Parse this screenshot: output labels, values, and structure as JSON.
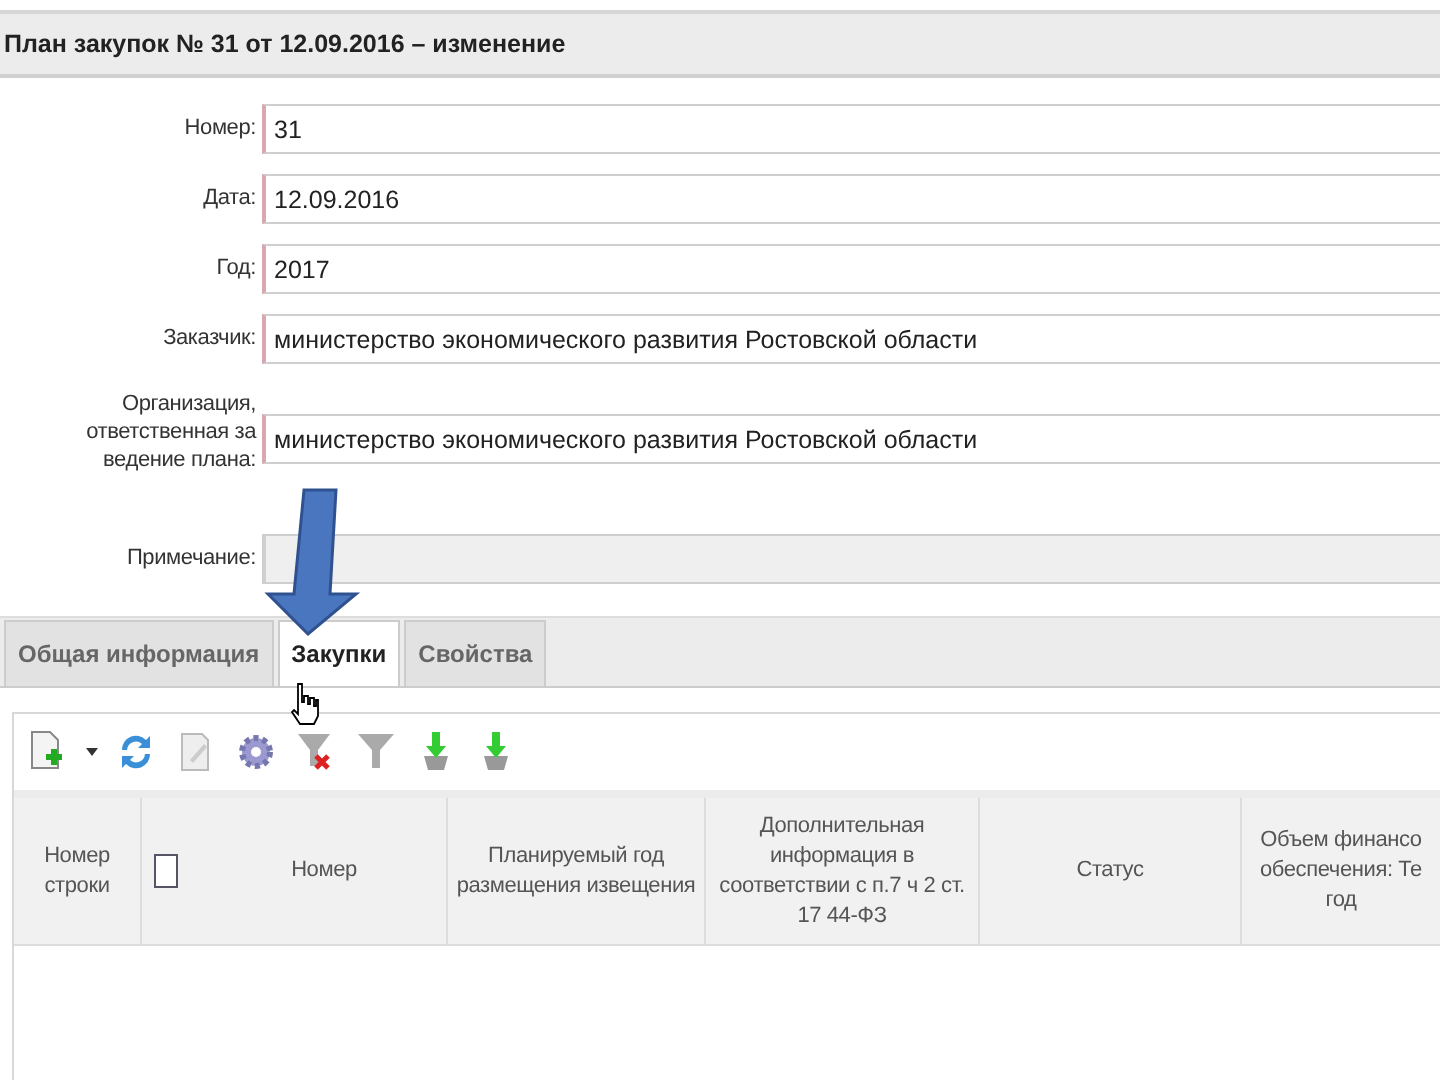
{
  "window": {
    "title": "План закупок № 31 от 12.09.2016 – изменение"
  },
  "form": [
    {
      "label": "Номер:",
      "value": "31",
      "kind": "text"
    },
    {
      "label": "Дата:",
      "value": "12.09.2016",
      "kind": "text"
    },
    {
      "label": "Год:",
      "value": "2017",
      "kind": "text"
    },
    {
      "label": "Заказчик:",
      "value": "министерство экономического развития Ростовской области",
      "kind": "text"
    },
    {
      "label": "Организация, ответственная за ведение плана:",
      "value": "министерство экономического развития Ростовской области",
      "kind": "tall"
    },
    {
      "label": "Примечание:",
      "kind": "note"
    }
  ],
  "tabs": [
    {
      "label": "Общая информация",
      "selected": false
    },
    {
      "label": "Закупки",
      "selected": true
    },
    {
      "label": "Свойства",
      "selected": false
    }
  ],
  "toolbar": [
    {
      "kind": "add"
    },
    {
      "kind": "refresh"
    },
    {
      "kind": "edit"
    },
    {
      "kind": "settings"
    },
    {
      "kind": "filter-clear"
    },
    {
      "kind": "filter"
    },
    {
      "kind": "download"
    },
    {
      "kind": "download"
    }
  ],
  "table": {
    "columns": [
      {
        "lines": [
          "Номер",
          "строки"
        ]
      },
      {
        "kind": "checkbox",
        "checked": false
      },
      {
        "lines": [
          "Номер"
        ]
      },
      {
        "lines": [
          "Планируемый год",
          "размещения извещения"
        ]
      },
      {
        "lines": [
          "Дополнительная",
          "информация в",
          "соответствии с п.7 ч 2 ст.",
          "17 44-ФЗ"
        ]
      },
      {
        "lines": [
          "Статус"
        ]
      },
      {
        "lines": [
          "Объем финансо",
          "обеспечения: Те",
          "год"
        ]
      }
    ]
  }
}
